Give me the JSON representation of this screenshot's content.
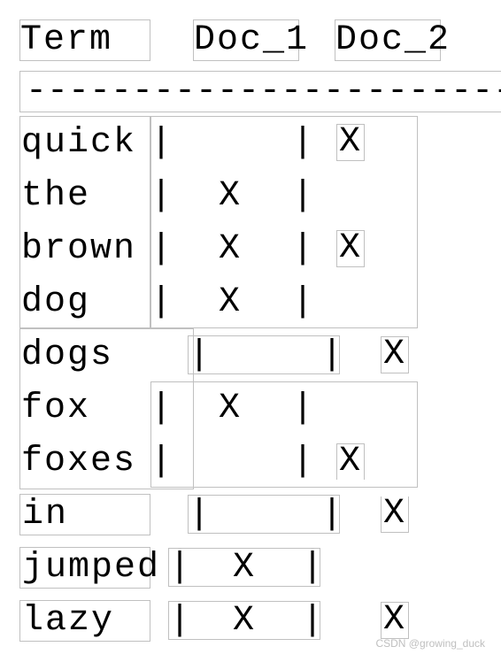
{
  "header": {
    "term": "Term",
    "doc1": "Doc_1",
    "doc2": "Doc_2"
  },
  "divider": "-------------------------",
  "sep": "|",
  "mark": "X",
  "rows": [
    {
      "term": "quick",
      "doc1": "",
      "doc2": "X"
    },
    {
      "term": "the",
      "doc1": "X",
      "doc2": ""
    },
    {
      "term": "brown",
      "doc1": "X",
      "doc2": "X"
    },
    {
      "term": "dog",
      "doc1": "X",
      "doc2": ""
    },
    {
      "term": "dogs",
      "doc1": "",
      "doc2": "X"
    },
    {
      "term": "fox",
      "doc1": "X",
      "doc2": ""
    },
    {
      "term": "foxes",
      "doc1": "",
      "doc2": "X"
    },
    {
      "term": "in",
      "doc1": "",
      "doc2": "X"
    },
    {
      "term": "jumped",
      "doc1": "X",
      "doc2": ""
    },
    {
      "term": "lazy",
      "doc1": "X",
      "doc2": "X"
    }
  ],
  "watermark": "CSDN @growing_duck"
}
